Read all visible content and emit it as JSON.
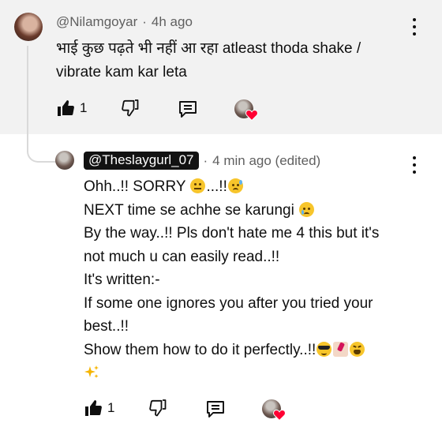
{
  "parent_comment": {
    "author": "@Nilamgoyar",
    "separator": "·",
    "time": "4h ago",
    "lines": [
      "भाई कुछ पढ़ते भी नहीं आ रहा atleast thoda shake /",
      "vibrate kam kar leta"
    ],
    "like_count": "1"
  },
  "reply": {
    "author": "@Theslaygurl_07",
    "separator": "·",
    "time": "4 min ago (edited)",
    "line1_text": "Ohh..!! SORRY ",
    "line1_mid": "...!!",
    "line2_text": "NEXT time se achhe se karungi ",
    "line3": "By the way..!! Pls don't hate me 4 this but it's",
    "line4": "not much u can easily read..!!",
    "line5": "It's written:-",
    "line6": "If some one ignores you after you tried your",
    "line7": "best..!!",
    "line8_text": "Show them how to do it perfectly..!!",
    "like_count": "1"
  },
  "icons": {
    "like": "thumbs-up-icon",
    "dislike": "thumbs-down-icon",
    "reply": "reply-comment-icon",
    "menu": "more-vertical-icon",
    "creator_heart": "creator-heart-icon"
  },
  "colors": {
    "heart": "#ff0033",
    "badge_bg": "#121212",
    "top_bg": "#f2f2f2"
  }
}
